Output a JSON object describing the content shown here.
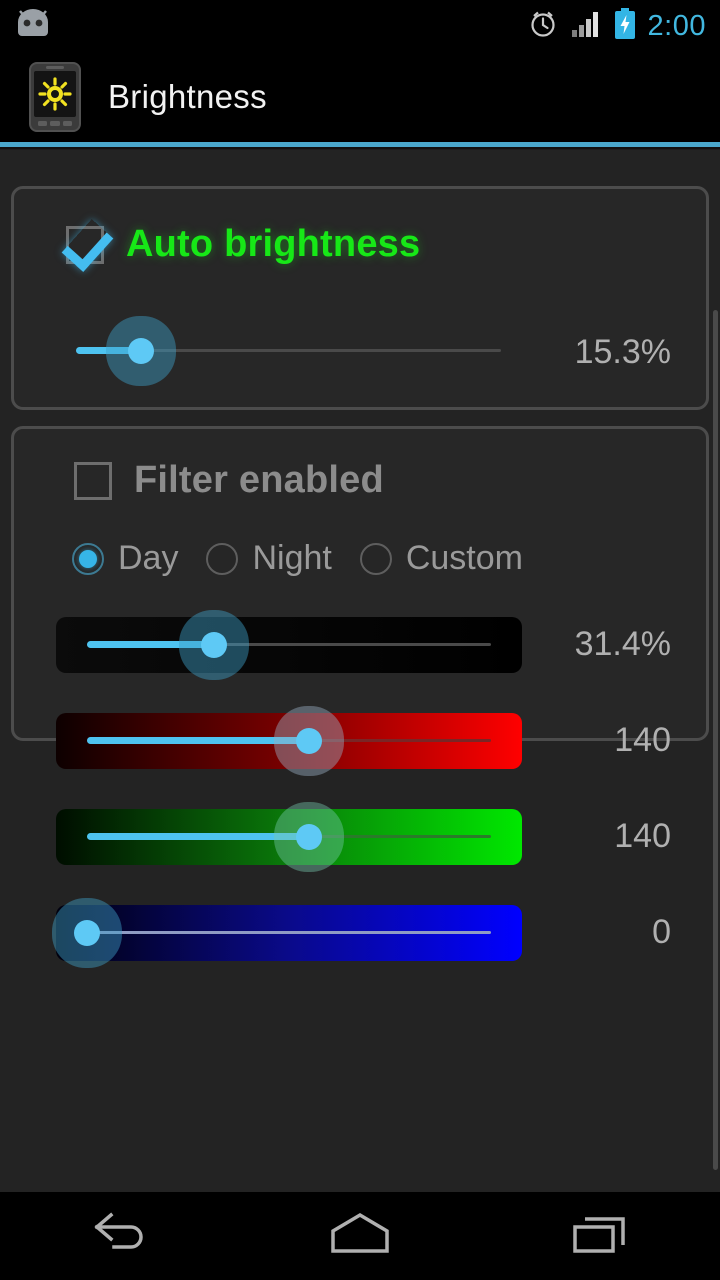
{
  "status_bar": {
    "notification_icon": "android-head-icon",
    "alarm_icon": "alarm-clock-icon",
    "signal_icon": "signal-bars-icon",
    "battery_icon": "battery-charging-icon",
    "clock": "2:00",
    "clock_color": "#42b8e0"
  },
  "action_bar": {
    "app_icon": "brightness-app-icon",
    "title": "Brightness",
    "divider_color": "#4aa8cd"
  },
  "auto_card": {
    "checkbox_label": "Auto brightness",
    "checkbox_checked": true,
    "label_color": "#17e817",
    "slider": {
      "name": "auto-brightness-slider",
      "value_text": "15.3%",
      "percent": 15.3
    }
  },
  "filter_card": {
    "checkbox_label": "Filter enabled",
    "checkbox_checked": false,
    "label_color": "#8c8c8c",
    "modes": [
      {
        "label": "Day",
        "selected": true
      },
      {
        "label": "Night",
        "selected": false
      },
      {
        "label": "Custom",
        "selected": false
      }
    ],
    "sliders": [
      {
        "name": "filter-intensity-slider",
        "value_text": "31.4%",
        "percent": 31.4,
        "bar_from": "#0b0b0b",
        "bar_to": "#000000"
      },
      {
        "name": "filter-red-slider",
        "value_text": "140",
        "percent": 54.9,
        "bar_from": "#0d0000",
        "bar_to": "#ff0000"
      },
      {
        "name": "filter-green-slider",
        "value_text": "140",
        "percent": 54.9,
        "bar_from": "#000d00",
        "bar_to": "#00e800"
      },
      {
        "name": "filter-blue-slider",
        "value_text": "0",
        "percent": 0,
        "bar_from": "#00000d",
        "bar_to": "#0000ff"
      }
    ]
  },
  "nav_bar": {
    "back": "back-icon",
    "home": "home-icon",
    "recents": "recent-apps-icon"
  }
}
